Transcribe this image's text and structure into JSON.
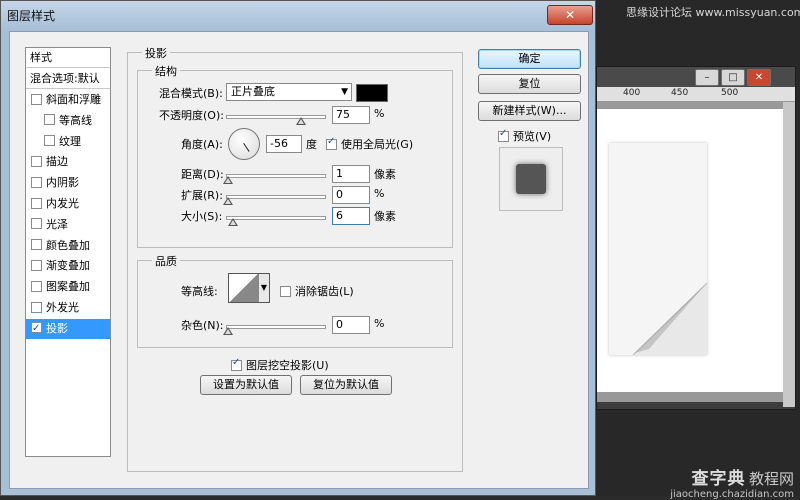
{
  "watermark": {
    "top": "思缘设计论坛 www.missyuan.com",
    "brand": "查字典",
    "brand2": "教程网",
    "url": "jiaocheng.chazidian.com"
  },
  "workspace": {
    "ruler_ticks": [
      "400",
      "450",
      "500"
    ],
    "win_buttons": [
      "–",
      "□",
      "✕"
    ]
  },
  "dialog": {
    "title": "图层样式",
    "close": "✕"
  },
  "style_list": {
    "header": "样式",
    "blend_options": "混合选项:默认",
    "items": [
      {
        "label": "斜面和浮雕",
        "checked": false,
        "indent": false
      },
      {
        "label": "等高线",
        "checked": false,
        "indent": true
      },
      {
        "label": "纹理",
        "checked": false,
        "indent": true
      },
      {
        "label": "描边",
        "checked": false,
        "indent": false
      },
      {
        "label": "内阴影",
        "checked": false,
        "indent": false
      },
      {
        "label": "内发光",
        "checked": false,
        "indent": false
      },
      {
        "label": "光泽",
        "checked": false,
        "indent": false
      },
      {
        "label": "颜色叠加",
        "checked": false,
        "indent": false
      },
      {
        "label": "渐变叠加",
        "checked": false,
        "indent": false
      },
      {
        "label": "图案叠加",
        "checked": false,
        "indent": false
      },
      {
        "label": "外发光",
        "checked": false,
        "indent": false
      },
      {
        "label": "投影",
        "checked": true,
        "indent": false,
        "selected": true
      }
    ]
  },
  "shadow": {
    "title": "投影",
    "structure_title": "结构",
    "blend_mode_label": "混合模式(B):",
    "blend_mode_value": "正片叠底",
    "color": "#000000",
    "opacity_label": "不透明度(O):",
    "opacity_value": "75",
    "opacity_fraction": 0.75,
    "percent": "%",
    "angle_label": "角度(A):",
    "angle_value": "-56",
    "angle_unit": "度",
    "global_light_label": "使用全局光(G)",
    "global_light_checked": true,
    "distance_label": "距离(D):",
    "distance_value": "1",
    "px_unit": "像素",
    "spread_label": "扩展(R):",
    "spread_value": "0",
    "size_label": "大小(S):",
    "size_value": "6",
    "quality_title": "品质",
    "contour_label": "等高线:",
    "antialias_label": "消除锯齿(L)",
    "antialias_checked": false,
    "noise_label": "杂色(N):",
    "noise_value": "0",
    "knockout_label": "图层挖空投影(U)",
    "knockout_checked": true,
    "set_default": "设置为默认值",
    "reset_default": "复位为默认值"
  },
  "buttons": {
    "ok": "确定",
    "reset": "复位",
    "new_style": "新建样式(W)...",
    "preview_label": "预览(V)",
    "preview_checked": true
  }
}
